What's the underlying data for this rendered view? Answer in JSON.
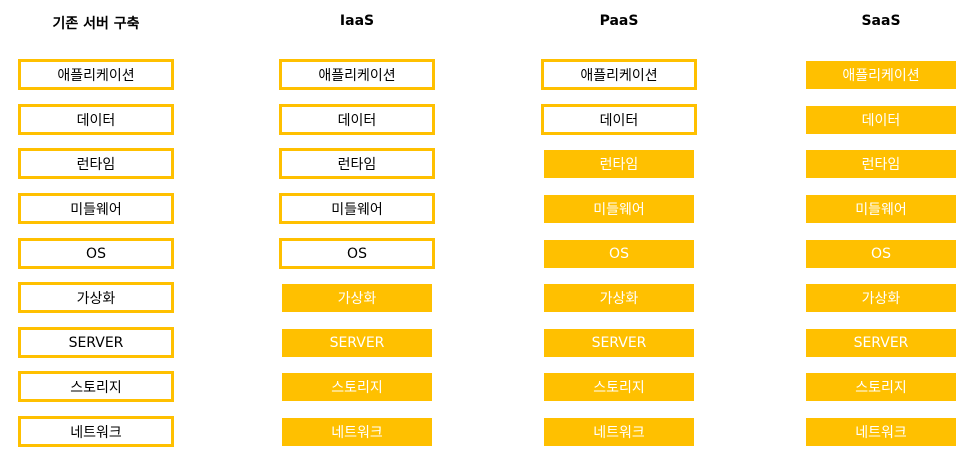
{
  "colors": {
    "accent": "#ffc000",
    "outline_fill": "#ffffff",
    "outline_text": "#000000",
    "filled_text": "#ffffff"
  },
  "columns": [
    {
      "key": "on-premise",
      "title": "기존 서버 구축",
      "layers": [
        {
          "label": "애플리케이션",
          "style": "outlined"
        },
        {
          "label": "데이터",
          "style": "outlined"
        },
        {
          "label": "런타임",
          "style": "outlined"
        },
        {
          "label": "미들웨어",
          "style": "outlined"
        },
        {
          "label": "OS",
          "style": "outlined"
        },
        {
          "label": "가상화",
          "style": "outlined"
        },
        {
          "label": "SERVER",
          "style": "outlined"
        },
        {
          "label": "스토리지",
          "style": "outlined"
        },
        {
          "label": "네트워크",
          "style": "outlined"
        }
      ]
    },
    {
      "key": "iaas",
      "title": "IaaS",
      "layers": [
        {
          "label": "애플리케이션",
          "style": "outlined"
        },
        {
          "label": "데이터",
          "style": "outlined"
        },
        {
          "label": "런타임",
          "style": "outlined"
        },
        {
          "label": "미들웨어",
          "style": "outlined"
        },
        {
          "label": "OS",
          "style": "outlined"
        },
        {
          "label": "가상화",
          "style": "managed"
        },
        {
          "label": "SERVER",
          "style": "managed"
        },
        {
          "label": "스토리지",
          "style": "managed"
        },
        {
          "label": "네트워크",
          "style": "managed"
        }
      ]
    },
    {
      "key": "paas",
      "title": "PaaS",
      "layers": [
        {
          "label": "애플리케이션",
          "style": "outlined"
        },
        {
          "label": "데이터",
          "style": "outlined"
        },
        {
          "label": "런타임",
          "style": "managed"
        },
        {
          "label": "미들웨어",
          "style": "managed"
        },
        {
          "label": "OS",
          "style": "managed"
        },
        {
          "label": "가상화",
          "style": "managed"
        },
        {
          "label": "SERVER",
          "style": "managed"
        },
        {
          "label": "스토리지",
          "style": "managed"
        },
        {
          "label": "네트워크",
          "style": "managed"
        }
      ]
    },
    {
      "key": "saas",
      "title": "SaaS",
      "layers": [
        {
          "label": "애플리케이션",
          "style": "managed"
        },
        {
          "label": "데이터",
          "style": "managed"
        },
        {
          "label": "런타임",
          "style": "managed"
        },
        {
          "label": "미들웨어",
          "style": "managed"
        },
        {
          "label": "OS",
          "style": "managed"
        },
        {
          "label": "가상화",
          "style": "managed"
        },
        {
          "label": "SERVER",
          "style": "managed"
        },
        {
          "label": "스토리지",
          "style": "managed"
        },
        {
          "label": "네트워크",
          "style": "managed"
        }
      ]
    }
  ]
}
